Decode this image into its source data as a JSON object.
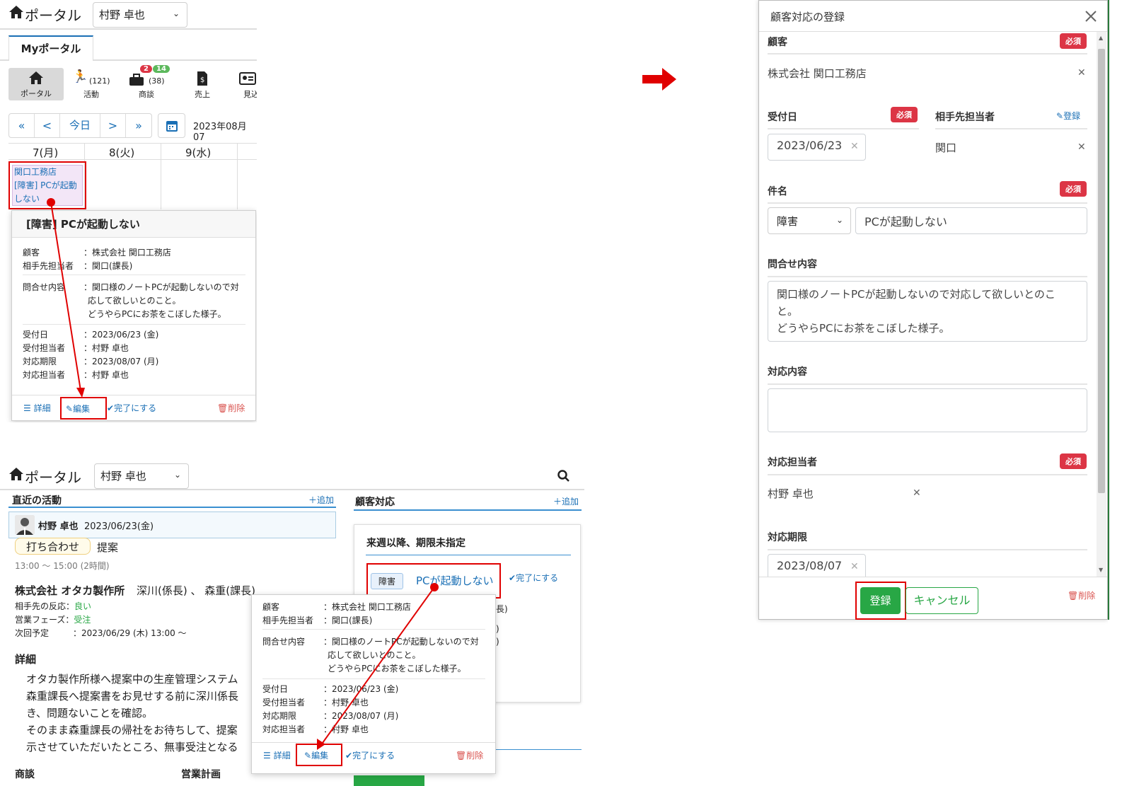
{
  "top_panel": {
    "brand": "ポータル",
    "user_select": "村野 卓也",
    "tab": "Myポータル",
    "nav": [
      {
        "label": "ポータル",
        "icon": "home-icon",
        "count": ""
      },
      {
        "label": "活動",
        "icon": "run-icon",
        "count": "(121)"
      },
      {
        "label": "商談",
        "icon": "briefcase-icon",
        "count": "(38)",
        "badge_red": "2",
        "badge_green": "14"
      },
      {
        "label": "売上",
        "icon": "receipt-icon",
        "count": ""
      },
      {
        "label": "見込",
        "icon": "id-card-icon",
        "count": ""
      }
    ],
    "cal_nav": [
      "«",
      "<",
      "今日",
      ">",
      "»"
    ],
    "date_label": "2023年08月07",
    "days": [
      "7(月)",
      "8(火)",
      "9(水)"
    ],
    "event": {
      "customer": "関口工務店",
      "title": "[障害] PCが起動しない"
    },
    "popover": {
      "title": "[障害] PCが起動しない",
      "rows": [
        {
          "k": "顧客",
          "v": "：株式会社 関口工務店"
        },
        {
          "k": "相手先担当者",
          "v": "：関口(課長)"
        }
      ],
      "inquiry_key": "問合せ内容",
      "inquiry_lines": [
        "：関口様のノートPCが起動しないので対",
        "応して欲しいとのこと。",
        "どうやらPCにお茶をこぼした様子。"
      ],
      "rows2": [
        {
          "k": "受付日",
          "v": "：2023/06/23 (金)"
        },
        {
          "k": "受付担当者",
          "v": "：村野 卓也"
        },
        {
          "k": "対応期限",
          "v": "：2023/08/07 (月)"
        },
        {
          "k": "対応担当者",
          "v": "：村野 卓也"
        }
      ],
      "footer": {
        "detail": "詳細",
        "edit": "編集",
        "complete": "完了にする",
        "delete": "削除"
      }
    }
  },
  "bottom_panel": {
    "brand": "ポータル",
    "user_select": "村野 卓也",
    "recent": {
      "title": "直近の活動",
      "add": "追加"
    },
    "activity": {
      "user": "村野 卓也",
      "date": "2023/06/23(金)",
      "tag": "打ち合わせ",
      "type": "提案",
      "time": "13:00 ～ 15:00 (2時間)"
    },
    "company": {
      "name": "株式会社 オタカ製作所",
      "people": "深川(係長) 、 森重(課長)"
    },
    "meta": [
      {
        "k": "相手先の反応",
        "v": "良い"
      },
      {
        "k": "営業フェーズ",
        "v": "受注"
      },
      {
        "k": "次回予定",
        "v": "：2023/06/29 (木) 13:00 ～"
      }
    ],
    "detail_title": "詳細",
    "detail_lines": [
      "オタカ製作所様へ提案中の生産管理システム",
      "森重課長へ提案書をお見せする前に深川係長",
      "き、問題ないことを確認。",
      "そのまま森重課長の帰社をお待ちして、提案",
      "示させていただいたところ、無事受注となる"
    ],
    "bottom_labels": [
      "商談",
      "営業計画"
    ],
    "support": {
      "title": "顧客対応",
      "add": "追加",
      "card_title": "来週以降、期限未指定",
      "tag": "障害",
      "link": "PCが起動しない",
      "complete": "完了にする"
    },
    "partial": [
      "長)",
      ")",
      ")"
    ],
    "popover": {
      "rows": [
        {
          "k": "顧客",
          "v": "：株式会社 関口工務店"
        },
        {
          "k": "相手先担当者",
          "v": "：関口(課長)"
        }
      ],
      "inquiry_key": "問合せ内容",
      "inquiry_lines": [
        "：関口様のノートPCが起動しないので対",
        "応して欲しいとのこと。",
        "どうやらPCにお茶をこぼした様子。"
      ],
      "rows2": [
        {
          "k": "受付日",
          "v": "：2023/06/23 (金)"
        },
        {
          "k": "受付担当者",
          "v": "：村野 卓也"
        },
        {
          "k": "対応期限",
          "v": "：2023/08/07 (月)"
        },
        {
          "k": "対応担当者",
          "v": "：村野 卓也"
        }
      ],
      "footer": {
        "detail": "詳細",
        "edit": "編集",
        "complete": "完了にする",
        "delete": "削除"
      }
    }
  },
  "modal": {
    "title": "顧客対応の登録",
    "required": "必須",
    "customer_label": "顧客",
    "customer_value": "株式会社 関口工務店",
    "date_label": "受付日",
    "date_value": "2023/06/23",
    "contact_label": "相手先担当者",
    "contact_register": "登録",
    "contact_value": "関口",
    "subject_label": "件名",
    "subject_type": "障害",
    "subject_value": "PCが起動しない",
    "inquiry_label": "問合せ内容",
    "inquiry_lines": [
      "関口様のノートPCが起動しないので対応して欲しいとのこ",
      "と。",
      "どうやらPCにお茶をこぼした様子。"
    ],
    "response_label": "対応内容",
    "response_value": "",
    "assignee_label": "対応担当者",
    "assignee_value": "村野 卓也",
    "deadline_label": "対応期限",
    "deadline_value": "2023/08/07",
    "submit": "登録",
    "cancel": "キャンセル",
    "delete": "削除"
  },
  "colors": {
    "accent_red": "#e00000",
    "link_blue": "#1a6fb5",
    "green": "#28a745",
    "danger": "#dc3545"
  }
}
